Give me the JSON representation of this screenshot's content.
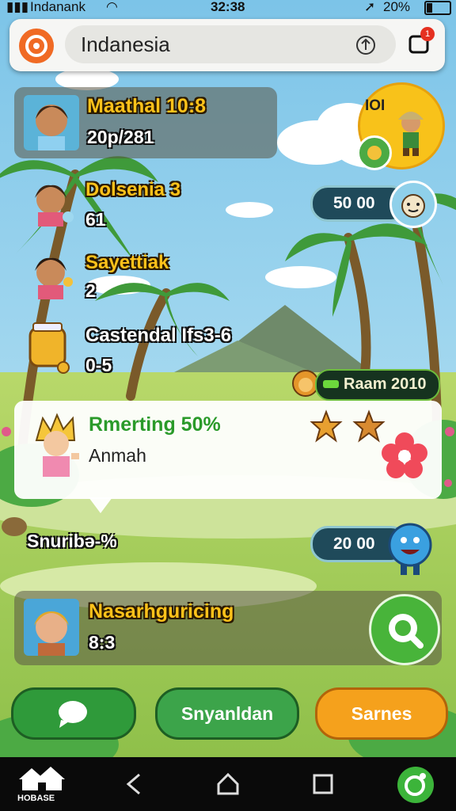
{
  "status_bar": {
    "carrier": "Indanank",
    "time": "32:38",
    "battery": "20%"
  },
  "search": {
    "value": "Indanesia",
    "notification_count": "1"
  },
  "players": [
    {
      "name": "Maathal 10:8",
      "score": "20p/281"
    },
    {
      "name": "Dolsenia 3",
      "score": "61"
    },
    {
      "name": "Sayettiak",
      "score": "2"
    },
    {
      "name": "Castendal Ifs3-6",
      "score": "0-5"
    }
  ],
  "top_right": {
    "label": "IOI"
  },
  "resources": {
    "coins": "50 00",
    "gems": "20 00",
    "level_tag": "Raam 2010"
  },
  "quest_card": {
    "title": "Rmerting 50%",
    "subtitle": "Anmah"
  },
  "floating_label": "Snuribə-%",
  "bottom_player": {
    "name": "Nasarhguricing",
    "score": "8:3"
  },
  "actions": {
    "secondary": "Snyanldan",
    "primary": "Sarnes"
  },
  "navbar": {
    "home_label": "HOBASE"
  },
  "colors": {
    "green": "#2f9a3a",
    "orange": "#f5a11c",
    "gold": "#ffc21a",
    "sky": "#a9dcf0",
    "grass": "#a8cf5a"
  }
}
